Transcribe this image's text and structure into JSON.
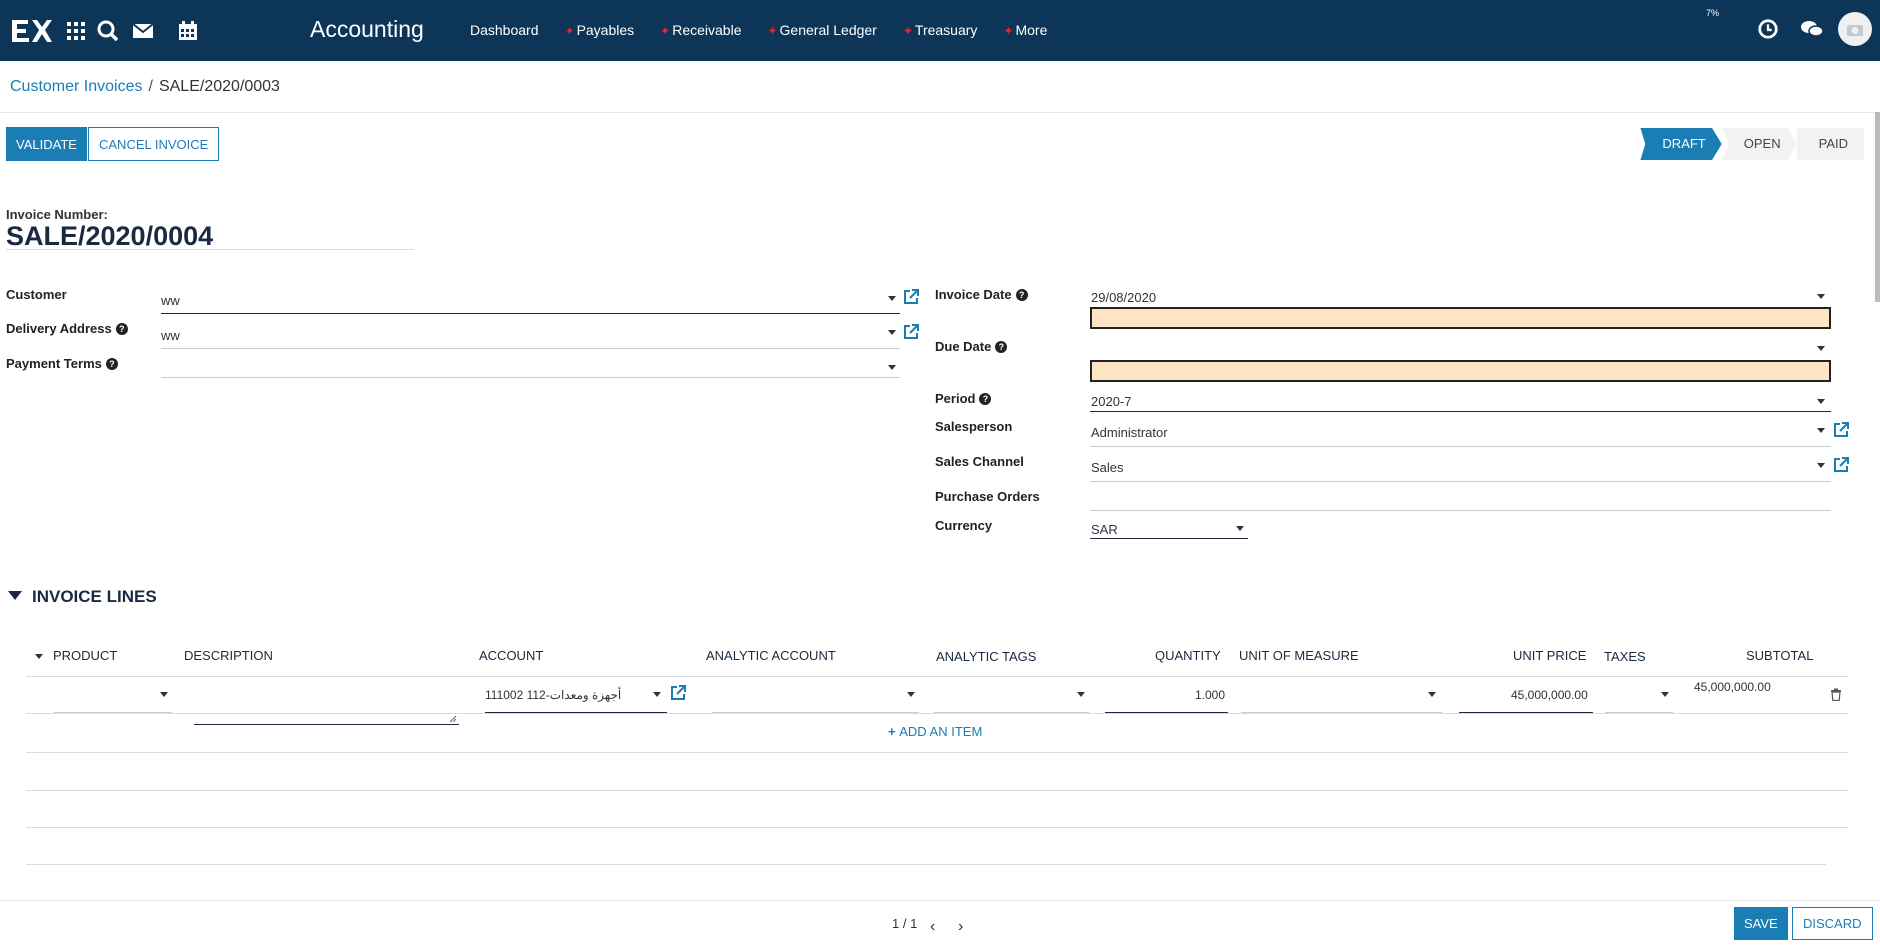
{
  "topbar": {
    "app_title": "Accounting",
    "menu": [
      {
        "label": "Dashboard",
        "starred": false
      },
      {
        "label": "Payables",
        "starred": true
      },
      {
        "label": "Receivable",
        "starred": true
      },
      {
        "label": "General Ledger",
        "starred": true
      },
      {
        "label": "Treasuary",
        "starred": true
      },
      {
        "label": "More",
        "starred": true
      }
    ],
    "small_indicator": "7%",
    "icons": [
      "apps-grid-icon",
      "search-icon",
      "mail-icon",
      "calendar-icon",
      "clock-icon",
      "chat-icon",
      "avatar-icon"
    ]
  },
  "breadcrumb": {
    "parent": "Customer Invoices",
    "separator": "/",
    "current": "SALE/2020/0003"
  },
  "actions": {
    "validate": "Validate",
    "cancel": "Cancel Invoice"
  },
  "status": {
    "steps": [
      "Draft",
      "Open",
      "Paid"
    ],
    "active": "Draft"
  },
  "invoice": {
    "number_label": "Invoice Number:",
    "number": "SALE/2020/0004"
  },
  "left_fields": {
    "customer_label": "Customer",
    "customer_value": "ww",
    "delivery_label": "Delivery Address",
    "delivery_value": "ww",
    "terms_label": "Payment Terms",
    "terms_value": ""
  },
  "right_fields": {
    "invoice_date_label": "Invoice Date",
    "invoice_date_value": "29/08/2020",
    "due_date_label": "Due Date",
    "due_date_value": "",
    "period_label": "Period",
    "period_value": "2020-7",
    "salesperson_label": "Salesperson",
    "salesperson_value": "Administrator",
    "channel_label": "Sales Channel",
    "channel_value": "Sales",
    "po_label": "Purchase Orders",
    "po_value": "",
    "currency_label": "Currency",
    "currency_value": "SAR"
  },
  "lines": {
    "section_title": "Invoice Lines",
    "columns": [
      "Product",
      "Description",
      "Account",
      "Analytic Account",
      "Analytic Tags",
      "Quantity",
      "Unit of Measure",
      "Unit Price",
      "Taxes",
      "Subtotal"
    ],
    "rows": [
      {
        "product": "",
        "description": "",
        "account": "111002 112-أجهزة ومعدات",
        "analytic_account": "",
        "analytic_tags": "",
        "quantity": "1.000",
        "uom": "",
        "unit_price": "45,000,000.00",
        "taxes": "",
        "subtotal": "45,000,000.00"
      }
    ],
    "add_item": "Add an item"
  },
  "footer": {
    "pager": "1 / 1",
    "save": "Save",
    "discard": "Discard"
  },
  "colors": {
    "topbar": "#0d3557",
    "accent": "#1a7db3",
    "required_bg": "#fde4c3",
    "star": "#e1262d"
  }
}
